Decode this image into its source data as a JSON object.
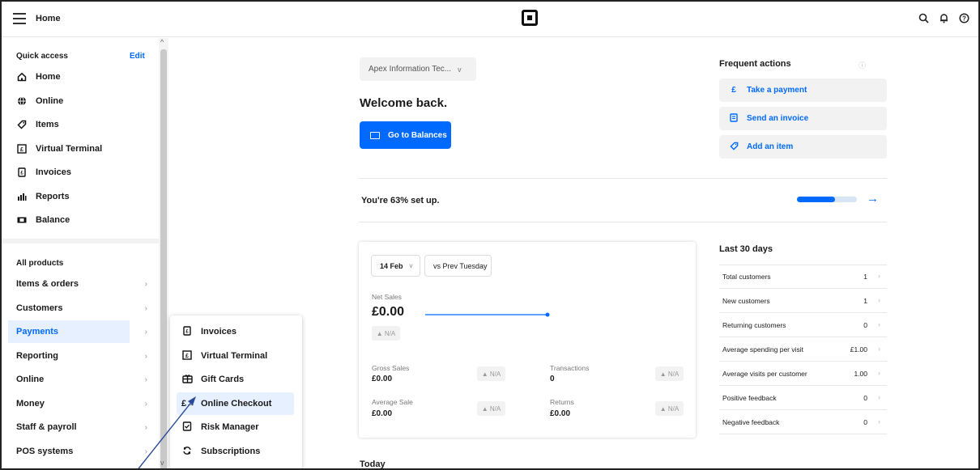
{
  "header": {
    "title": "Home",
    "icons": [
      "menu-icon",
      "square-logo",
      "search-icon",
      "bell-icon",
      "help-icon"
    ]
  },
  "sidebar": {
    "quick_access_title": "Quick access",
    "edit_label": "Edit",
    "quick_access": [
      {
        "label": "Home",
        "icon": "home-icon"
      },
      {
        "label": "Online",
        "icon": "globe-icon"
      },
      {
        "label": "Items",
        "icon": "tag-icon"
      },
      {
        "label": "Virtual Terminal",
        "icon": "terminal-icon"
      },
      {
        "label": "Invoices",
        "icon": "invoice-icon"
      },
      {
        "label": "Reports",
        "icon": "chart-icon"
      },
      {
        "label": "Balance",
        "icon": "balance-icon"
      }
    ],
    "all_products_title": "All products",
    "all_products": [
      {
        "label": "Items & orders"
      },
      {
        "label": "Customers"
      },
      {
        "label": "Payments",
        "active": true
      },
      {
        "label": "Reporting"
      },
      {
        "label": "Online"
      },
      {
        "label": "Money"
      },
      {
        "label": "Staff & payroll"
      },
      {
        "label": "POS systems"
      }
    ]
  },
  "flyout": {
    "items": [
      {
        "label": "Invoices",
        "icon": "invoice-icon"
      },
      {
        "label": "Virtual Terminal",
        "icon": "terminal-icon"
      },
      {
        "label": "Gift Cards",
        "icon": "gift-card-icon"
      },
      {
        "label": "Online Checkout",
        "icon": "checkout-icon",
        "active": true
      },
      {
        "label": "Risk Manager",
        "icon": "shield-icon"
      },
      {
        "label": "Subscriptions",
        "icon": "refresh-icon"
      }
    ]
  },
  "main": {
    "store_select": "Apex Information Tec...",
    "welcome": "Welcome back.",
    "balance_button": "Go to Balances",
    "setup_text": "You're 63% set up.",
    "setup_progress": 0.63,
    "today_title": "Today"
  },
  "frequent_actions": {
    "title": "Frequent actions",
    "items": [
      {
        "label": "Take a payment",
        "icon": "pound-icon"
      },
      {
        "label": "Send an invoice",
        "icon": "invoice-icon"
      },
      {
        "label": "Add an item",
        "icon": "tag-icon"
      }
    ]
  },
  "sales_card": {
    "date_select": "14 Feb",
    "compare_label": "vs Prev Tuesday",
    "net_sales_label": "Net Sales",
    "net_sales_value": "£0.00",
    "na": "▲ N/A",
    "gross_sales_label": "Gross Sales",
    "gross_sales_value": "£0.00",
    "transactions_label": "Transactions",
    "transactions_value": "0",
    "average_sale_label": "Average Sale",
    "average_sale_value": "£0.00",
    "returns_label": "Returns",
    "returns_value": "£0.00"
  },
  "last_30_days": {
    "title": "Last 30 days",
    "rows": [
      {
        "label": "Total customers",
        "value": "1"
      },
      {
        "label": "New customers",
        "value": "1"
      },
      {
        "label": "Returning customers",
        "value": "0"
      },
      {
        "label": "Average spending per visit",
        "value": "£1.00"
      },
      {
        "label": "Average visits per customer",
        "value": "1.00"
      },
      {
        "label": "Positive feedback",
        "value": "0"
      },
      {
        "label": "Negative feedback",
        "value": "0"
      }
    ]
  },
  "colors": {
    "accent": "#006aff",
    "active_bg": "#e7f0ff",
    "muted_bg": "#f2f2f2"
  }
}
